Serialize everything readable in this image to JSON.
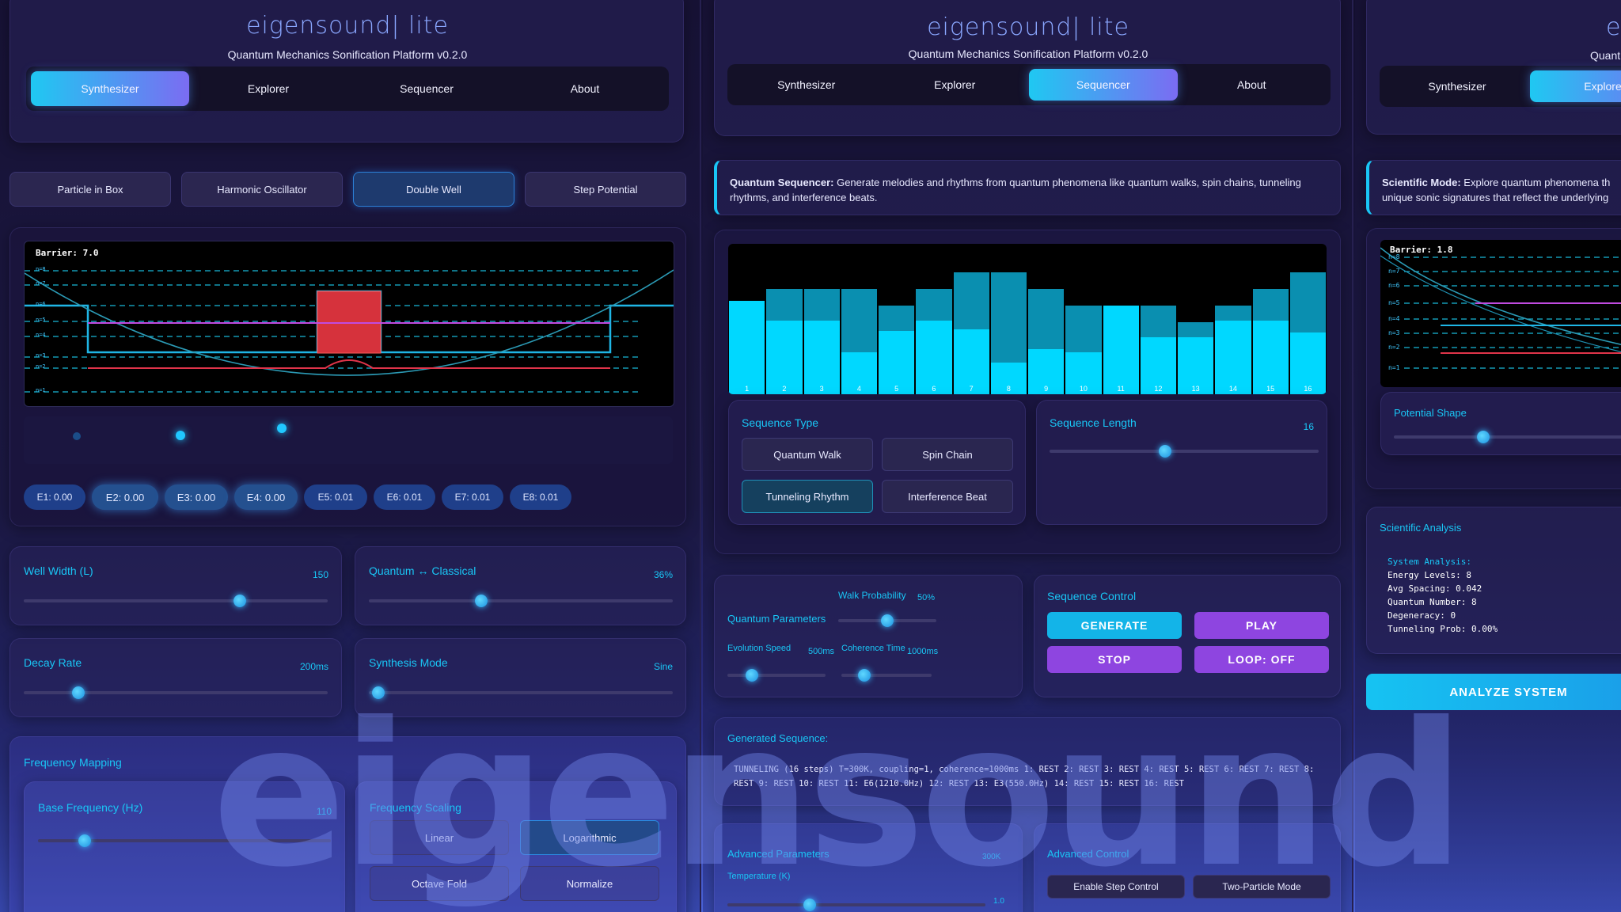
{
  "app": {
    "title": "eigensound| lite",
    "subtitle": "Quantum Mechanics Sonification Platform v0.2.0"
  },
  "tabs": [
    "Synthesizer",
    "Explorer",
    "Sequencer",
    "About"
  ],
  "s3_tabs": [
    "Synthesizer",
    "Explore"
  ],
  "s3_title": "eig",
  "s3_subtitle": "Quantum M",
  "synth": {
    "potentials": [
      "Particle in Box",
      "Harmonic Oscillator",
      "Double Well",
      "Step Potential"
    ],
    "barrier_text": "Barrier: 7.0",
    "level_labels": [
      "n=8",
      "n=7",
      "n=6",
      "n=5",
      "n=4",
      "n=3",
      "n=2",
      "n=1"
    ],
    "energy_chips": [
      "E1: 0.00",
      "E2: 0.00",
      "E3: 0.00",
      "E4: 0.00",
      "E5: 0.01",
      "E6: 0.01",
      "E7: 0.01",
      "E8: 0.01"
    ],
    "well_width": {
      "label": "Well Width (L)",
      "value": "150",
      "fraction": 0.71
    },
    "quantum_classical": {
      "label": "Quantum ↔ Classical",
      "value": "36%",
      "fraction": 0.37
    },
    "decay_rate": {
      "label": "Decay Rate",
      "value": "200ms",
      "fraction": 0.18
    },
    "synthesis_mode": {
      "label": "Synthesis Mode",
      "value": "Sine",
      "fraction": 0.03
    },
    "frequency_mapping": "Frequency Mapping",
    "base_frequency": {
      "label": "Base Frequency (Hz)",
      "value": "110",
      "fraction": 0.16
    },
    "frequency_scaling": {
      "label": "Frequency Scaling",
      "options": [
        "Linear",
        "Logarithmic",
        "Octave Fold",
        "Normalize"
      ]
    }
  },
  "sequencer": {
    "info_bold": "Quantum Sequencer:",
    "info_text": " Generate melodies and rhythms from quantum phenomena like quantum walks, spin chains, tunneling rhythms, and interference beats.",
    "bars": [
      {
        "step": "1",
        "total": 0.62,
        "dark": 0.0
      },
      {
        "step": "2",
        "total": 0.7,
        "dark": 0.21
      },
      {
        "step": "3",
        "total": 0.7,
        "dark": 0.21
      },
      {
        "step": "4",
        "total": 0.7,
        "dark": 0.42
      },
      {
        "step": "5",
        "total": 0.59,
        "dark": 0.17
      },
      {
        "step": "6",
        "total": 0.7,
        "dark": 0.21
      },
      {
        "step": "7",
        "total": 0.81,
        "dark": 0.38
      },
      {
        "step": "8",
        "total": 0.81,
        "dark": 0.6
      },
      {
        "step": "9",
        "total": 0.7,
        "dark": 0.4
      },
      {
        "step": "10",
        "total": 0.59,
        "dark": 0.31
      },
      {
        "step": "11",
        "total": 0.59,
        "dark": 0.0
      },
      {
        "step": "12",
        "total": 0.59,
        "dark": 0.21
      },
      {
        "step": "13",
        "total": 0.48,
        "dark": 0.1
      },
      {
        "step": "14",
        "total": 0.59,
        "dark": 0.1
      },
      {
        "step": "15",
        "total": 0.7,
        "dark": 0.21
      },
      {
        "step": "16",
        "total": 0.81,
        "dark": 0.4
      }
    ],
    "sequence_type": {
      "label": "Sequence Type",
      "options": [
        "Quantum Walk",
        "Spin Chain",
        "Tunneling Rhythm",
        "Interference Beat"
      ],
      "active": "Tunneling Rhythm"
    },
    "sequence_length": {
      "label": "Sequence Length",
      "value": "16",
      "fraction": 0.43
    },
    "quantum_parameters": "Quantum Parameters",
    "walk_probability": {
      "label": "Walk Probability",
      "value": "50%",
      "fraction": 0.5
    },
    "evolution_speed": {
      "label": "Evolution Speed",
      "value": "500ms",
      "fraction": 0.25
    },
    "coherence_time": {
      "label": "Coherence Time",
      "value": "1000ms",
      "fraction": 0.25
    },
    "sequence_control": {
      "label": "Sequence Control",
      "generate": "GENERATE",
      "play": "PLAY",
      "stop": "STOP",
      "loop": "LOOP: OFF"
    },
    "generated_label": "Generated Sequence:",
    "generated_text": "TUNNELING (16 steps) T=300K, coupling=1, coherence=1000ms 1: REST 2: REST 3: REST 4: REST 5: REST 6: REST 7: REST 8: REST 9: REST 10: REST 11: E6(1210.0Hz) 12: REST 13: E3(550.0Hz) 14: REST 15: REST 16: REST",
    "advanced_parameters": "Advanced Parameters",
    "adv_value": "300K",
    "temperature": {
      "label": "Temperature (K)",
      "value": "1.0",
      "fraction": 0.32
    },
    "advanced_control": {
      "label": "Advanced Control",
      "enable_step": "Enable Step Control",
      "two_particle": "Two-Particle Mode"
    }
  },
  "explorer": {
    "info_bold": "Scientific Mode:",
    "info_text_1": " Explore quantum phenomena th",
    "info_text_2": "unique sonic signatures that reflect the underlying",
    "barrier_text": "Barrier: 1.8",
    "level_labels": [
      "n=8",
      "n=7",
      "n=6",
      "n=5",
      "n=4",
      "n=3",
      "n=2",
      "n=1"
    ],
    "potential_shape": {
      "label": "Potential Shape",
      "fraction": 0.35
    },
    "analysis_label": "Scientific Analysis",
    "analysis_lines": [
      "System Analysis:",
      "Energy Levels: 8",
      "Avg Spacing: 0.042",
      "Quantum Number: 8",
      "Degeneracy: 0",
      "Tunneling Prob: 0.00%"
    ],
    "analyze_button": "ANALYZE SYSTEM"
  },
  "watermark": "eigensound",
  "colors": {
    "accent_cyan": "#19c6f5",
    "accent_purple": "#9b4de8",
    "bar_bright": "#00d8ff",
    "bar_dark": "#0a8fb0",
    "well_red": "#e5333f"
  }
}
